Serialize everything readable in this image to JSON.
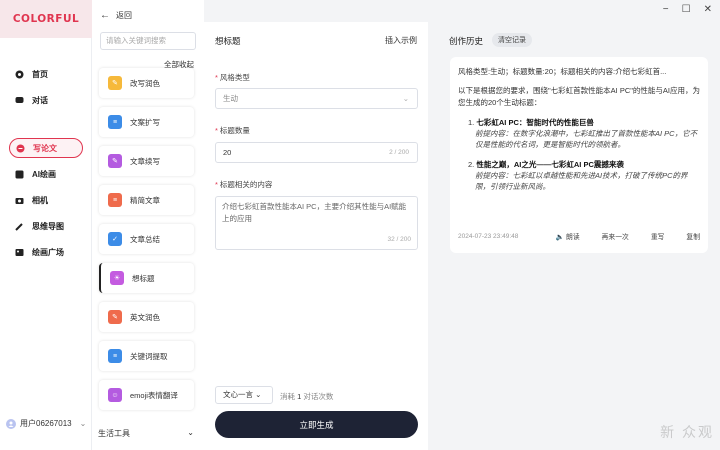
{
  "brand": {
    "logo_text": "COLORFUL",
    "accent": "#e0354f"
  },
  "nav": {
    "items": [
      {
        "label": "首页",
        "icon": "home-icon"
      },
      {
        "label": "对话",
        "icon": "chat-icon"
      },
      {
        "label": "写论文",
        "icon": "paper-icon",
        "active": true
      },
      {
        "label": "AI绘画",
        "icon": "ai-paint-icon"
      },
      {
        "label": "相机",
        "icon": "camera-icon"
      },
      {
        "label": "思维导图",
        "icon": "mindmap-icon"
      },
      {
        "label": "绘画广场",
        "icon": "gallery-icon"
      }
    ],
    "user": "用户06267013"
  },
  "tools": {
    "back_label": "返回",
    "search_placeholder": "请输入关键词搜索",
    "collapse_all": "全部收起",
    "items": [
      {
        "label": "改写润色",
        "color": "#f6b93b"
      },
      {
        "label": "文案扩写",
        "color": "#3c8ce7"
      },
      {
        "label": "文章续写",
        "color": "#b45be0"
      },
      {
        "label": "精简文章",
        "color": "#ef6b4c"
      },
      {
        "label": "文章总结",
        "color": "#3c8ce7"
      },
      {
        "label": "想标题",
        "color": "#c45be0",
        "active": true
      },
      {
        "label": "英文润色",
        "color": "#ef6b4c"
      },
      {
        "label": "关键词提取",
        "color": "#3c8ce7"
      },
      {
        "label": "emoji表情翻译",
        "color": "#b45be0"
      }
    ],
    "life_tools": "生活工具"
  },
  "form": {
    "title": "想标题",
    "insert_example": "插入示例",
    "style_label": "风格类型",
    "style_value": "生动",
    "count_label": "标题数量",
    "count_value": "20",
    "count_counter": "2 / 200",
    "content_label": "标题相关的内容",
    "content_value": "介绍七彩虹首款性能本AI PC，主要介绍其性能与AI赋能上的应用",
    "content_counter": "32 / 200",
    "model": "文心一言",
    "cost_prefix": "消耗",
    "cost_value": "1",
    "cost_suffix": "对话次数",
    "generate": "立即生成"
  },
  "history": {
    "title": "创作历史",
    "clear": "清空记录",
    "query": "风格类型:生动；标题数量:20；标题相关的内容:介绍七彩虹首...",
    "intro": "以下是根据您的要求，围绕\"七彩虹首款性能本AI PC\"的性能与AI应用，为您生成的20个生动标题：",
    "results": [
      {
        "num": "1.",
        "title": "七彩虹AI PC：智能时代的性能巨兽",
        "desc": "前提内容：在数字化浪潮中，七彩虹推出了首款性能本AI PC，它不仅是性能的代名词，更是智能时代的领航者。"
      },
      {
        "num": "2.",
        "title": "性能之巅，AI之光——七彩虹AI PC震撼来袭",
        "desc": "前提内容：七彩虹以卓越性能和先进AI技术，打破了传统PC的界限，引领行业新风尚。"
      }
    ],
    "timestamp": "2024-07-23 23:49:48",
    "actions": [
      "朗读",
      "再来一次",
      "重写",
      "复制"
    ]
  },
  "watermark": "新 众观"
}
